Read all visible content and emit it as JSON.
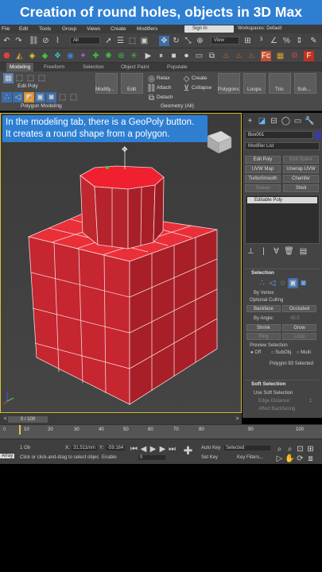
{
  "banner": {
    "title": "Creation of round holes, objects in 3D Max"
  },
  "menu": {
    "items": [
      "File",
      "Edit",
      "Tools",
      "Group",
      "Views",
      "Create",
      "Modifiers"
    ],
    "signin": "Sign In",
    "workspaces": "Workspaces: Default"
  },
  "toolbar": {
    "filter": "All",
    "view": "View"
  },
  "ribbon": {
    "tabs": [
      "Modeling",
      "Freeform",
      "Selection",
      "Object Paint",
      "Populate"
    ],
    "edit_poly": "Edit Poly",
    "modify": "Modify...",
    "edit": "Edit",
    "relax": "Relax",
    "create": "Create",
    "attach": "Attach",
    "collapse": "Collapse",
    "detach": "Detach",
    "polygons": "Polygons",
    "loops": "Loops",
    "tris": "Tris",
    "sub": "Sub...",
    "poly_modeling": "Polygon Modeling",
    "geometry_all": "Geometry (All)"
  },
  "viewport": {
    "tooltip_line1": "In the modeling tab, there is a GeoPoly button.",
    "tooltip_line2": "It creates a round shape from a polygon."
  },
  "command_panel": {
    "object_name": "Box001",
    "modifier_list": "Modifier List",
    "buttons": [
      "Edit Poly",
      "Edit Spline",
      "UVW Map",
      "Unwrap UVW",
      "TurboSmooth",
      "Chamfer",
      "Sweep",
      "Shell"
    ],
    "stack_item": "Editable Poly",
    "selection_title": "Selection",
    "by_vertex": "By Vertex",
    "optional_culling": "Optional Culling",
    "backface": "Backface",
    "occluded": "Occluded",
    "by_angle": "By Angle:",
    "angle_value": "45.0",
    "shrink": "Shrink",
    "grow": "Grow",
    "ring": "Ring",
    "loop": "Loop",
    "preview_selection": "Preview Selection",
    "off": "Off",
    "subobj": "SubObj",
    "multi": "Multi",
    "selected_info": "Polygon 93 Selected",
    "soft_selection_title": "Soft Selection",
    "use_soft": "Use Soft Selection",
    "edge_distance": "Edge Distance:",
    "edge_value": "1",
    "affect_backfacing": "Affect Backfacing"
  },
  "timeline": {
    "frame": "0 / 100",
    "ticks": [
      "10",
      "20",
      "30",
      "40",
      "50",
      "60",
      "70",
      "80",
      "90",
      "100"
    ]
  },
  "status": {
    "script": "Array",
    "objects": "1 Ob",
    "prompt": "Click or click-and-drag to select objec",
    "x_label": "X:",
    "x_value": "31.511mm",
    "y_label": "Y:",
    "y_value": "-59.164",
    "enable": "Enable",
    "frame_value": "0",
    "auto_key": "Auto Key",
    "selected": "Selected",
    "set_key": "Set Key",
    "key_filters": "Key Filters..."
  },
  "colors": {
    "accent": "#2e7fd2",
    "object": "#e8303a",
    "viewport_border": "#d8c23a"
  }
}
